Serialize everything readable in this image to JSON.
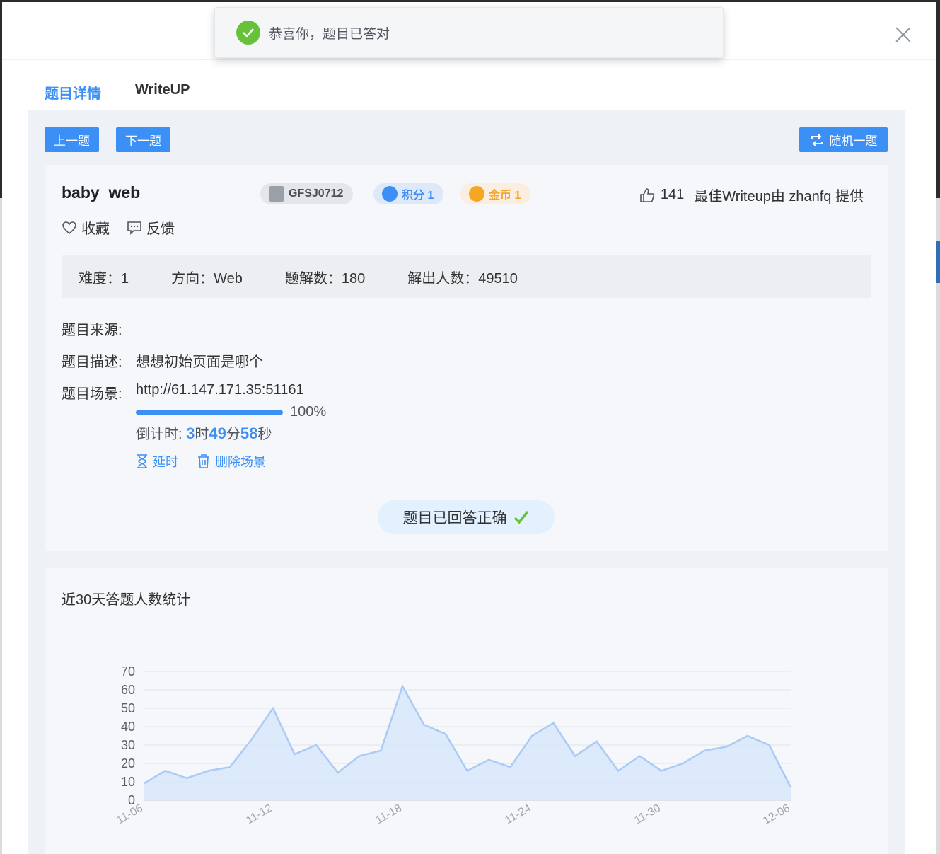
{
  "toast": {
    "message": "恭喜你，题目已答对"
  },
  "tabs": [
    {
      "label": "题目详情",
      "active": true
    },
    {
      "label": "WriteUP",
      "active": false
    }
  ],
  "nav": {
    "prev": "上一题",
    "next": "下一题",
    "random": "随机一题"
  },
  "challenge": {
    "title": "baby_web",
    "id_badge": "GFSJ0712",
    "points_badge": "积分 1",
    "coins_badge": "金币 1",
    "likes": "141",
    "best_writeup": "最佳Writeup由 zhanfq 提供",
    "favorite": "收藏",
    "feedback": "反馈"
  },
  "stats": {
    "difficulty": "难度：1",
    "direction": "方向：Web",
    "solves": "题解数：180",
    "solvers": "解出人数：49510"
  },
  "details": {
    "source_label": "题目来源:",
    "source_value": "",
    "desc_label": "题目描述:",
    "desc_value": "想想初始页面是哪个",
    "scene_label": "题目场景:",
    "scene_url": "http://61.147.171.35:51161",
    "progress": 100,
    "progress_text": "100%",
    "countdown_label": "倒计时: ",
    "cd_h": "3",
    "cd_h_unit": "时",
    "cd_m": "49",
    "cd_m_unit": "分",
    "cd_s": "58",
    "cd_s_unit": "秒",
    "extend": "延时",
    "delete_scene": "删除场景"
  },
  "answered": {
    "text": "题目已回答正确"
  },
  "colors": {
    "accent": "#3b8ff5",
    "success": "#67c23a",
    "coin": "#f5a623"
  },
  "chart_data": {
    "type": "area",
    "title": "近30天答题人数统计",
    "x_ticks": [
      "11-06",
      "11-12",
      "11-18",
      "11-24",
      "11-30",
      "12-06"
    ],
    "y_ticks": [
      0,
      10,
      20,
      30,
      40,
      50,
      60,
      70
    ],
    "ylim": [
      0,
      70
    ],
    "x": [
      "11-06",
      "11-07",
      "11-08",
      "11-09",
      "11-10",
      "11-11",
      "11-12",
      "11-13",
      "11-14",
      "11-15",
      "11-16",
      "11-17",
      "11-18",
      "11-19",
      "11-20",
      "11-21",
      "11-22",
      "11-23",
      "11-24",
      "11-25",
      "11-26",
      "11-27",
      "11-28",
      "11-29",
      "11-30",
      "12-01",
      "12-02",
      "12-03",
      "12-04",
      "12-05",
      "12-06"
    ],
    "values": [
      9,
      16,
      12,
      16,
      18,
      33,
      50,
      25,
      30,
      15,
      24,
      27,
      62,
      41,
      36,
      16,
      22,
      18,
      35,
      42,
      24,
      32,
      16,
      24,
      16,
      20,
      27,
      29,
      35,
      30,
      7
    ],
    "grid": true
  }
}
